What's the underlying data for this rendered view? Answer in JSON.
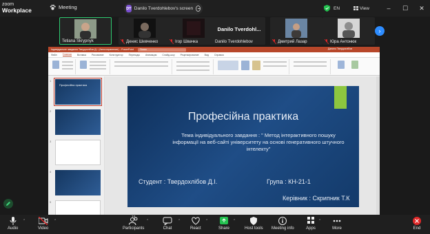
{
  "app": {
    "logo_line1": "zoom",
    "logo_line2": "Workplace",
    "meeting_label": "Meeting"
  },
  "share_indicator": {
    "initials": "DT",
    "text": "Danilo Tverdohlebov's screen"
  },
  "window": {
    "language": "EN",
    "view_label": "View",
    "minimize": "–",
    "maximize": "☐",
    "close": "✕"
  },
  "participants": [
    {
      "name": "Tetiana Skrypnyk",
      "active": true
    },
    {
      "name": "Денис Шевченко"
    },
    {
      "name": "Ігор Швачка"
    },
    {
      "name": "Danilo Tverdohlebov",
      "display": "Danilo  Tverdohl..."
    },
    {
      "name": "Дмитрий Лазар"
    },
    {
      "name": "Юра Антонюк"
    }
  ],
  "ppt": {
    "title": "Індивідуальне завдання Твердохлібов Д.І. (Автосохранение) – PowerPoint",
    "search_placeholder": "Поиск",
    "user": "Данило Твердохлібов",
    "tabs": [
      "Файл",
      "Главная",
      "Вставка",
      "Рисование",
      "Конструктор",
      "Переходы",
      "Анимация",
      "Слайд-шоу",
      "Рецензирование",
      "Вид",
      "Справка"
    ],
    "thumb_title": "Професійна практика",
    "thumb_numbers": [
      "1",
      "2",
      "3",
      "4",
      "5"
    ]
  },
  "slide": {
    "title": "Професійна практика",
    "subtitle": "Тема індивідуального завдання : \" Метод інтерактивного пошуку інформації на веб-сайті університету на основі генеративного штучного інтелекту\"",
    "student": "Студент : Твердохлібов Д.І.",
    "group": "Група : КН-21-1",
    "supervisor": "Керівник : Скрипник Т.К"
  },
  "toolbar": {
    "audio": "Audio",
    "video": "Video",
    "participants": "Participants",
    "participants_count": "15",
    "chat": "Chat",
    "react": "React",
    "share": "Share",
    "host_tools": "Host tools",
    "meeting_info": "Meeting info",
    "apps": "Apps",
    "more": "More",
    "end": "End"
  },
  "colors": {
    "accent_green": "#2ecc71",
    "share_green": "#23c14f",
    "end_red": "#e02828",
    "slide_blue": "#1f4d86",
    "ppt_red": "#b7472a"
  }
}
